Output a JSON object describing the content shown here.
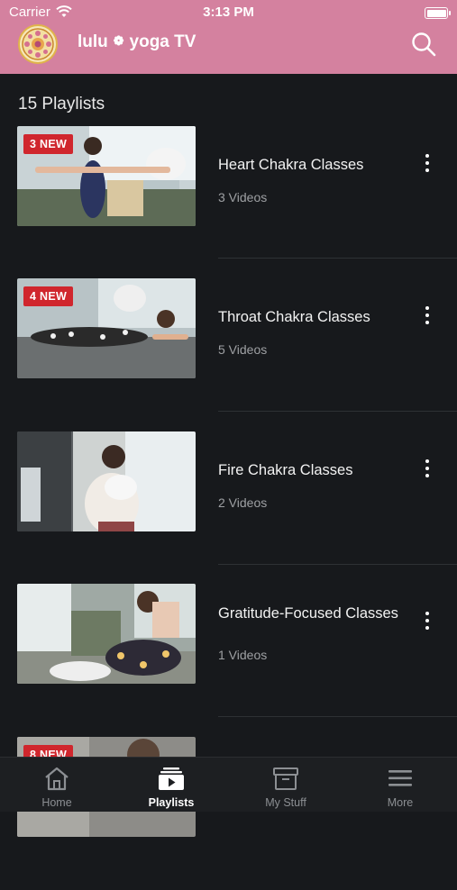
{
  "status_bar": {
    "carrier": "Carrier",
    "time": "3:13 PM"
  },
  "header": {
    "brand_left": "lulu",
    "brand_sep": "❁",
    "brand_right": "yoga TV"
  },
  "playlists_count": "15 Playlists",
  "playlists": [
    {
      "title": "Heart Chakra Classes",
      "subtitle": "3 Videos",
      "badge": "3 NEW"
    },
    {
      "title": "Throat Chakra Classes",
      "subtitle": "5 Videos",
      "badge": "4 NEW"
    },
    {
      "title": "Fire Chakra Classes",
      "subtitle": "2 Videos",
      "badge": ""
    },
    {
      "title": "Gratitude-Focused Classes",
      "subtitle": "1 Videos",
      "badge": ""
    },
    {
      "title": "",
      "subtitle": "",
      "badge": "8 NEW"
    }
  ],
  "tabs": [
    {
      "label": "Home",
      "icon": "home-icon",
      "active": false
    },
    {
      "label": "Playlists",
      "icon": "playlists-icon",
      "active": true
    },
    {
      "label": "My Stuff",
      "icon": "archive-box-icon",
      "active": false
    },
    {
      "label": "More",
      "icon": "menu-icon",
      "active": false
    }
  ],
  "colors": {
    "header": "#d4819f",
    "background": "#17191c",
    "badge": "#d0262d",
    "tabbar": "#1d1f22"
  }
}
